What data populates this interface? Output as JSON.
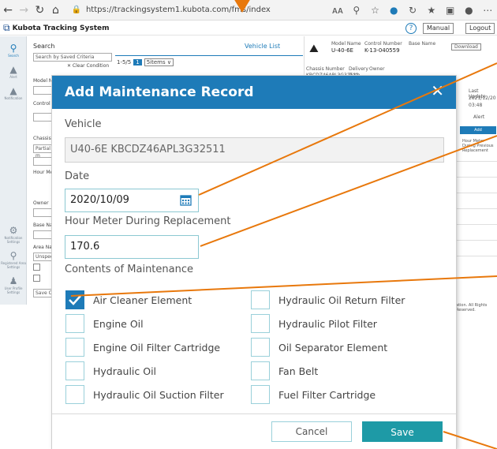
{
  "browser": {
    "url": "https://trackingsystem1.kubota.com/fms/index",
    "zoom_text": "A⁠A"
  },
  "app": {
    "title": "Kubota Tracking System",
    "manual_label": "Manual",
    "logout_label": "Logout"
  },
  "sidebar": {
    "items": [
      {
        "label": "Search",
        "icon": "search-icon"
      },
      {
        "label": "Alert",
        "icon": "alert-icon"
      },
      {
        "label": "Notification",
        "icon": "notification-icon"
      },
      {
        "label": "Notification Settings",
        "icon": "settings-icon"
      },
      {
        "label": "Registered Area Settings",
        "icon": "area-icon"
      },
      {
        "label": "User Profile Settings",
        "icon": "user-icon"
      }
    ]
  },
  "search": {
    "title": "Search",
    "saved_placeholder": "Search by Saved Criteria",
    "clear_label": "✕ Clear Condition",
    "model_label": "Model N",
    "control_label": "Control",
    "chassis_label": "Chassis",
    "partial_label": "Partial m",
    "hour_label": "Hour Me",
    "owner_label": "Owner",
    "base_label": "Base Na",
    "area_label": "Area Na",
    "unspec_label": "Unspeci",
    "save_label": "Save Co"
  },
  "list": {
    "tab_label": "Vehicle List",
    "pager_text": "1-5/5",
    "page_number": "1",
    "per_page": "5items ∨"
  },
  "detail": {
    "model_name_label": "Model Name",
    "model_name": "U-40-6E",
    "control_number_label": "Control Number",
    "control_number": "K-13-040559",
    "base_name_label": "Base Name",
    "download_label": "Download",
    "chassis_label": "Chassis Number",
    "chassis_value": "KBCDZ46APL3G32511",
    "delivery_label": "Delivery",
    "delivery_value": "Date",
    "owner_label": "Owner",
    "last_update_label": "Last Update",
    "last_update_value": "2021/12/20",
    "last_update_time": "03:48",
    "alert_label": "Alert",
    "add_label": "Add",
    "hour_meter_header": "Hour Meter During Previous Replacement",
    "footer_text": "ation. All Rights Reserved."
  },
  "modal": {
    "title": "Add Maintenance Record",
    "close_icon": "close-icon",
    "vehicle_label": "Vehicle",
    "vehicle_value": "U40-6E KBCDZ46APL3G32511",
    "date_label": "Date",
    "date_value": "2020/10/09",
    "hour_meter_label": "Hour Meter During Replacement",
    "hour_meter_value": "170.6",
    "contents_label": "Contents of Maintenance",
    "items_left": [
      {
        "label": "Air Cleaner Element",
        "checked": true
      },
      {
        "label": "Engine Oil",
        "checked": false
      },
      {
        "label": "Engine Oil Filter Cartridge",
        "checked": false
      },
      {
        "label": "Hydraulic Oil",
        "checked": false
      },
      {
        "label": "Hydraulic Oil Suction Filter",
        "checked": false
      }
    ],
    "items_right": [
      {
        "label": "Hydraulic Oil Return Filter",
        "checked": false
      },
      {
        "label": "Hydraulic Pilot Filter",
        "checked": false
      },
      {
        "label": "Oil Separator Element",
        "checked": false
      },
      {
        "label": "Fan Belt",
        "checked": false
      },
      {
        "label": "Fuel Filter Cartridge",
        "checked": false
      }
    ],
    "cancel_label": "Cancel",
    "save_label": "Save"
  },
  "colors": {
    "accent": "#1e7bb8",
    "save_button": "#1e9aa6",
    "callout": "#e8780c",
    "field_border": "#8cc8d2"
  }
}
